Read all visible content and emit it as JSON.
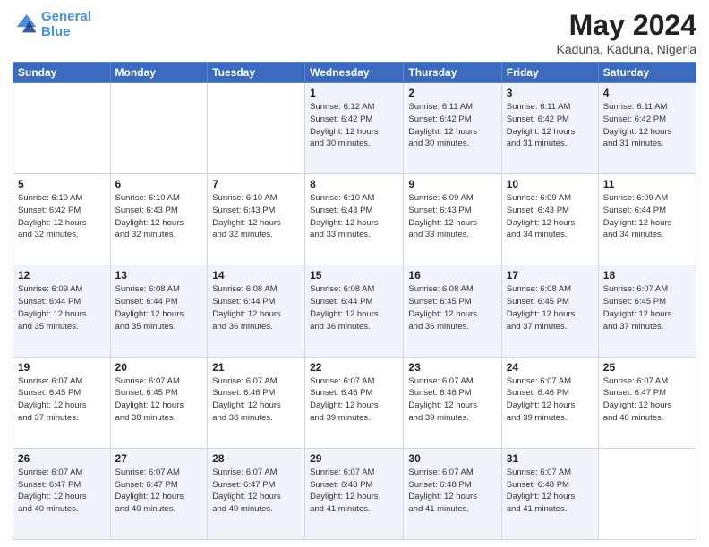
{
  "logo": {
    "line1": "General",
    "line2": "Blue"
  },
  "title": "May 2024",
  "subtitle": "Kaduna, Kaduna, Nigeria",
  "weekdays": [
    "Sunday",
    "Monday",
    "Tuesday",
    "Wednesday",
    "Thursday",
    "Friday",
    "Saturday"
  ],
  "rows": [
    [
      {
        "num": "",
        "info": ""
      },
      {
        "num": "",
        "info": ""
      },
      {
        "num": "",
        "info": ""
      },
      {
        "num": "1",
        "info": "Sunrise: 6:12 AM\nSunset: 6:42 PM\nDaylight: 12 hours\nand 30 minutes."
      },
      {
        "num": "2",
        "info": "Sunrise: 6:11 AM\nSunset: 6:42 PM\nDaylight: 12 hours\nand 30 minutes."
      },
      {
        "num": "3",
        "info": "Sunrise: 6:11 AM\nSunset: 6:42 PM\nDaylight: 12 hours\nand 31 minutes."
      },
      {
        "num": "4",
        "info": "Sunrise: 6:11 AM\nSunset: 6:42 PM\nDaylight: 12 hours\nand 31 minutes."
      }
    ],
    [
      {
        "num": "5",
        "info": "Sunrise: 6:10 AM\nSunset: 6:42 PM\nDaylight: 12 hours\nand 32 minutes."
      },
      {
        "num": "6",
        "info": "Sunrise: 6:10 AM\nSunset: 6:43 PM\nDaylight: 12 hours\nand 32 minutes."
      },
      {
        "num": "7",
        "info": "Sunrise: 6:10 AM\nSunset: 6:43 PM\nDaylight: 12 hours\nand 32 minutes."
      },
      {
        "num": "8",
        "info": "Sunrise: 6:10 AM\nSunset: 6:43 PM\nDaylight: 12 hours\nand 33 minutes."
      },
      {
        "num": "9",
        "info": "Sunrise: 6:09 AM\nSunset: 6:43 PM\nDaylight: 12 hours\nand 33 minutes."
      },
      {
        "num": "10",
        "info": "Sunrise: 6:09 AM\nSunset: 6:43 PM\nDaylight: 12 hours\nand 34 minutes."
      },
      {
        "num": "11",
        "info": "Sunrise: 6:09 AM\nSunset: 6:44 PM\nDaylight: 12 hours\nand 34 minutes."
      }
    ],
    [
      {
        "num": "12",
        "info": "Sunrise: 6:09 AM\nSunset: 6:44 PM\nDaylight: 12 hours\nand 35 minutes."
      },
      {
        "num": "13",
        "info": "Sunrise: 6:08 AM\nSunset: 6:44 PM\nDaylight: 12 hours\nand 35 minutes."
      },
      {
        "num": "14",
        "info": "Sunrise: 6:08 AM\nSunset: 6:44 PM\nDaylight: 12 hours\nand 36 minutes."
      },
      {
        "num": "15",
        "info": "Sunrise: 6:08 AM\nSunset: 6:44 PM\nDaylight: 12 hours\nand 36 minutes."
      },
      {
        "num": "16",
        "info": "Sunrise: 6:08 AM\nSunset: 6:45 PM\nDaylight: 12 hours\nand 36 minutes."
      },
      {
        "num": "17",
        "info": "Sunrise: 6:08 AM\nSunset: 6:45 PM\nDaylight: 12 hours\nand 37 minutes."
      },
      {
        "num": "18",
        "info": "Sunrise: 6:07 AM\nSunset: 6:45 PM\nDaylight: 12 hours\nand 37 minutes."
      }
    ],
    [
      {
        "num": "19",
        "info": "Sunrise: 6:07 AM\nSunset: 6:45 PM\nDaylight: 12 hours\nand 37 minutes."
      },
      {
        "num": "20",
        "info": "Sunrise: 6:07 AM\nSunset: 6:45 PM\nDaylight: 12 hours\nand 38 minutes."
      },
      {
        "num": "21",
        "info": "Sunrise: 6:07 AM\nSunset: 6:46 PM\nDaylight: 12 hours\nand 38 minutes."
      },
      {
        "num": "22",
        "info": "Sunrise: 6:07 AM\nSunset: 6:46 PM\nDaylight: 12 hours\nand 39 minutes."
      },
      {
        "num": "23",
        "info": "Sunrise: 6:07 AM\nSunset: 6:46 PM\nDaylight: 12 hours\nand 39 minutes."
      },
      {
        "num": "24",
        "info": "Sunrise: 6:07 AM\nSunset: 6:46 PM\nDaylight: 12 hours\nand 39 minutes."
      },
      {
        "num": "25",
        "info": "Sunrise: 6:07 AM\nSunset: 6:47 PM\nDaylight: 12 hours\nand 40 minutes."
      }
    ],
    [
      {
        "num": "26",
        "info": "Sunrise: 6:07 AM\nSunset: 6:47 PM\nDaylight: 12 hours\nand 40 minutes."
      },
      {
        "num": "27",
        "info": "Sunrise: 6:07 AM\nSunset: 6:47 PM\nDaylight: 12 hours\nand 40 minutes."
      },
      {
        "num": "28",
        "info": "Sunrise: 6:07 AM\nSunset: 6:47 PM\nDaylight: 12 hours\nand 40 minutes."
      },
      {
        "num": "29",
        "info": "Sunrise: 6:07 AM\nSunset: 6:48 PM\nDaylight: 12 hours\nand 41 minutes."
      },
      {
        "num": "30",
        "info": "Sunrise: 6:07 AM\nSunset: 6:48 PM\nDaylight: 12 hours\nand 41 minutes."
      },
      {
        "num": "31",
        "info": "Sunrise: 6:07 AM\nSunset: 6:48 PM\nDaylight: 12 hours\nand 41 minutes."
      },
      {
        "num": "",
        "info": ""
      }
    ]
  ]
}
